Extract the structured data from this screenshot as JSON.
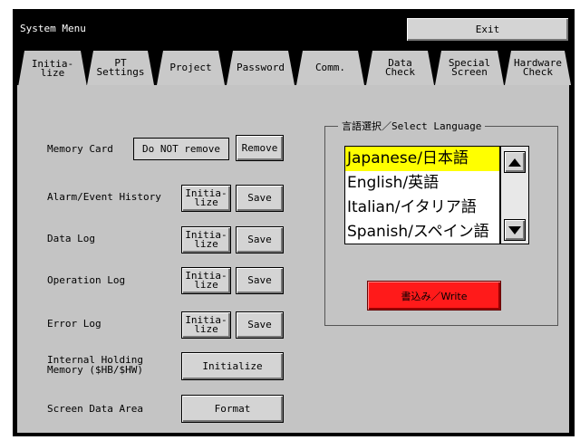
{
  "header": {
    "title": "System Menu",
    "exit_label": "Exit"
  },
  "tabs": [
    {
      "label": "Initia-\nlize"
    },
    {
      "label": "PT\nSettings"
    },
    {
      "label": "Project"
    },
    {
      "label": "Password"
    },
    {
      "label": "Comm."
    },
    {
      "label": "Data\nCheck"
    },
    {
      "label": "Special\nScreen"
    },
    {
      "label": "Hardware\nCheck"
    }
  ],
  "left": {
    "memory_card": {
      "label": "Memory Card",
      "status": "Do NOT remove",
      "remove_label": "Remove"
    },
    "alarm": {
      "label": "Alarm/Event History",
      "init_label": "Initia-\nlize",
      "save_label": "Save"
    },
    "data_log": {
      "label": "Data Log",
      "init_label": "Initia-\nlize",
      "save_label": "Save"
    },
    "operation_log": {
      "label": "Operation Log",
      "init_label": "Initia-\nlize",
      "save_label": "Save"
    },
    "error_log": {
      "label": "Error Log",
      "init_label": "Initia-\nlize",
      "save_label": "Save"
    },
    "holding": {
      "label": "Internal Holding\nMemory ($HB/$HW)",
      "button": "Initialize"
    },
    "screen_data": {
      "label": "Screen Data Area",
      "button": "Format"
    }
  },
  "language": {
    "title": "言語選択／Select Language",
    "items": [
      "Japanese/日本語",
      "English/英語",
      "Italian/イタリア語",
      "Spanish/スペイン語"
    ],
    "selected_index": 0,
    "write_label": "書込み／Write"
  },
  "colors": {
    "selected_bg": "#ffff00",
    "write_button": "#ff1a1a",
    "panel": "#c4c4c4",
    "frame": "#000000"
  }
}
